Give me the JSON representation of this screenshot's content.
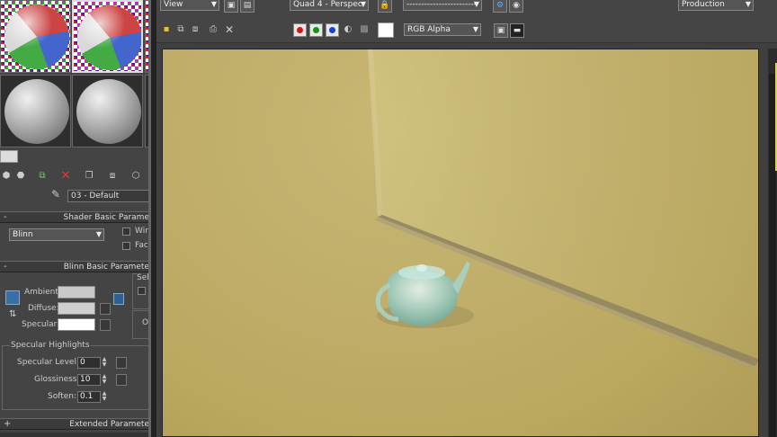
{
  "material_editor": {
    "material_name": "03 - Default",
    "shader_rollout": {
      "sign": "-",
      "title": "Shader Basic Parame",
      "shader": "Blinn",
      "wire_label": "Wire",
      "face_label": "Face"
    },
    "blinn_rollout": {
      "sign": "-",
      "title": "Blinn Basic Paramete",
      "self_label": "Self",
      "op_label": "Op",
      "ambient_label": "Ambient:",
      "diffuse_label": "Diffuse:",
      "specular_label": "Specular:",
      "ambient_color": "#c9c9c9",
      "diffuse_color": "#cfcfcf",
      "specular_color": "#ffffff"
    },
    "specular_highlights": {
      "title": "Specular Highlights",
      "level_label": "Specular Level:",
      "level_value": "0",
      "gloss_label": "Glossiness:",
      "gloss_value": "10",
      "soften_label": "Soften:",
      "soften_value": "0.1"
    },
    "extended_rollout": {
      "sign": "+",
      "title": "Extended Paramete"
    }
  },
  "render_window": {
    "area_dropdown": "View",
    "viewport_dropdown": "Quad 4 - Perspec",
    "preset_dropdown": "------------------------",
    "render_mode_dropdown": "Production",
    "channel_dropdown": "RGB Alpha",
    "channel_colors": {
      "red": "#d01818",
      "green": "#1a8f1a",
      "blue": "#1c3fd0"
    },
    "background_color": "#b8a862"
  }
}
